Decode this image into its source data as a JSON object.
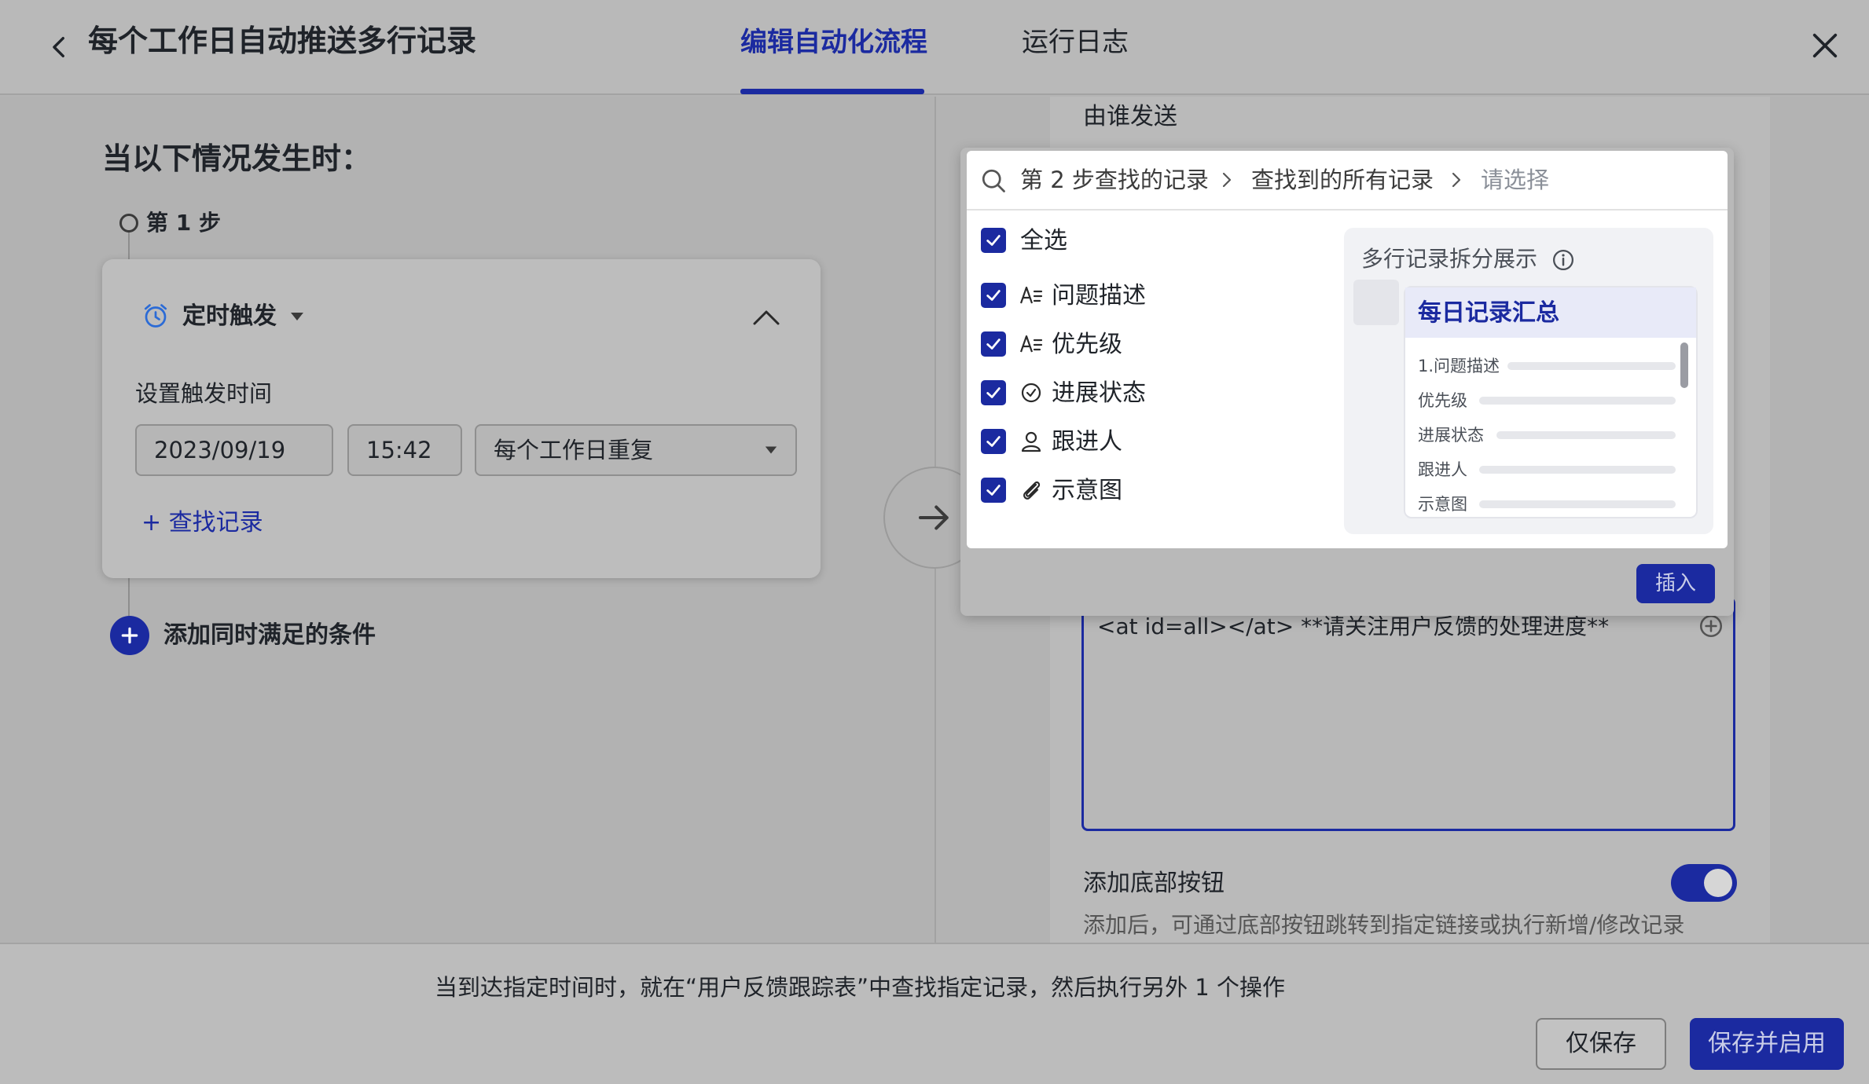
{
  "header": {
    "title": "每个工作日自动推送多行记录",
    "tabs": [
      {
        "label": "编辑自动化流程",
        "active": true
      },
      {
        "label": "运行日志",
        "active": false
      }
    ]
  },
  "left": {
    "when_title": "当以下情况发生时：",
    "step_label": "第 1 步",
    "trigger": {
      "label": "定时触发",
      "set_time_label": "设置触发时间",
      "date": "2023/09/19",
      "time": "15:42",
      "repeat": "每个工作日重复",
      "find_record": "查找记录"
    },
    "add_condition": "添加同时满足的条件"
  },
  "right": {
    "sender_label": "由谁发送",
    "message_text": "<at id=all></at> **请关注用户反馈的处理进度**",
    "bottom_button_label": "添加底部按钮",
    "bottom_button_desc": "添加后，可通过底部按钮跳转到指定链接或执行新增/修改记录",
    "bottom_button_enabled": true
  },
  "popup": {
    "breadcrumb": [
      "第 2 步查找的记录",
      "查找到的所有记录",
      "请选择"
    ],
    "select_all": "全选",
    "fields": [
      {
        "label": "问题描述",
        "icon": "text-field-icon",
        "checked": true
      },
      {
        "label": "优先级",
        "icon": "text-field-icon",
        "checked": true
      },
      {
        "label": "进展状态",
        "icon": "status-check-icon",
        "checked": true
      },
      {
        "label": "跟进人",
        "icon": "person-icon",
        "checked": true
      },
      {
        "label": "示意图",
        "icon": "attachment-icon",
        "checked": true
      }
    ],
    "preview_title": "多行记录拆分展示",
    "preview_card_title": "每日记录汇总",
    "preview_rows": [
      "1.问题描述",
      "优先级",
      "进展状态",
      "跟进人",
      "示意图"
    ],
    "insert_label": "插入"
  },
  "footer": {
    "summary": "当到达指定时间时，就在“用户反馈跟踪表”中查找指定记录，然后执行另外 1 个操作",
    "save_only": "仅保存",
    "save_enable": "保存并启用"
  },
  "colors": {
    "accent": "#1b2aa0",
    "overlay_gray": "#b4b4b4",
    "popup_white": "#ffffff"
  }
}
